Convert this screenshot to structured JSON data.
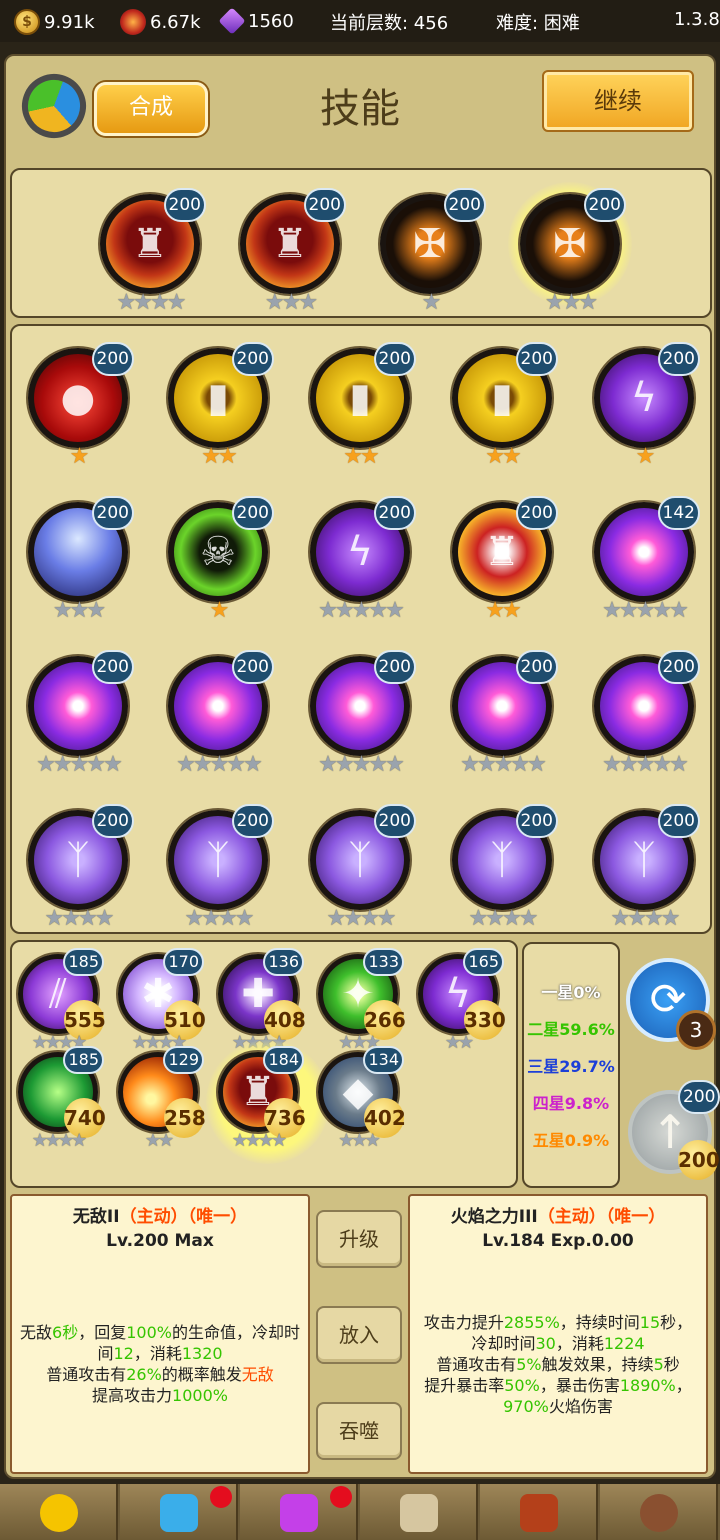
{
  "topbar": {
    "gold": "9.91k",
    "fire": "6.67k",
    "gem": "1560",
    "floor": "当前层数: 456",
    "difficulty": "难度: 困难",
    "version": "1.3.8"
  },
  "header": {
    "title": "技能",
    "compose_label": "合成",
    "continue_label": "继续"
  },
  "equipped": [
    {
      "icon": "crimson-armor-icon",
      "level": "200",
      "stars": 4,
      "filled": 0,
      "glow": false
    },
    {
      "icon": "crimson-armor-icon",
      "level": "200",
      "stars": 3,
      "filled": 0,
      "glow": false
    },
    {
      "icon": "holy-cross-icon",
      "level": "200",
      "stars": 1,
      "filled": 0,
      "glow": false
    },
    {
      "icon": "holy-cross-icon",
      "level": "200",
      "stars": 3,
      "filled": 0,
      "glow": true
    }
  ],
  "grid": [
    {
      "icon": "blood-drop-icon",
      "level": "200",
      "stars": 1,
      "filled": 1
    },
    {
      "icon": "gold-coin-icon",
      "level": "200",
      "stars": 2,
      "filled": 2
    },
    {
      "icon": "gold-coin-icon",
      "level": "200",
      "stars": 2,
      "filled": 2
    },
    {
      "icon": "gold-coin-icon",
      "level": "200",
      "stars": 2,
      "filled": 2
    },
    {
      "icon": "purple-lightning-icon",
      "level": "200",
      "stars": 1,
      "filled": 1
    },
    {
      "icon": "blue-spikes-icon",
      "level": "200",
      "stars": 3,
      "filled": 0
    },
    {
      "icon": "green-skull-icon",
      "level": "200",
      "stars": 1,
      "filled": 1
    },
    {
      "icon": "purple-lightning-icon",
      "level": "200",
      "stars": 5,
      "filled": 0
    },
    {
      "icon": "flame-armor-icon",
      "level": "200",
      "stars": 2,
      "filled": 2
    },
    {
      "icon": "vortex-icon",
      "level": "142",
      "stars": 5,
      "filled": 0
    },
    {
      "icon": "vortex-icon",
      "level": "200",
      "stars": 5,
      "filled": 0
    },
    {
      "icon": "vortex-icon",
      "level": "200",
      "stars": 5,
      "filled": 0
    },
    {
      "icon": "vortex-icon",
      "level": "200",
      "stars": 5,
      "filled": 0
    },
    {
      "icon": "vortex-icon",
      "level": "200",
      "stars": 5,
      "filled": 0
    },
    {
      "icon": "vortex-icon",
      "level": "200",
      "stars": 5,
      "filled": 0
    },
    {
      "icon": "shadow-rune-icon",
      "level": "200",
      "stars": 4,
      "filled": 0
    },
    {
      "icon": "shadow-rune-icon",
      "level": "200",
      "stars": 4,
      "filled": 0
    },
    {
      "icon": "shadow-rune-icon",
      "level": "200",
      "stars": 4,
      "filled": 0
    },
    {
      "icon": "shadow-rune-icon",
      "level": "200",
      "stars": 4,
      "filled": 0
    },
    {
      "icon": "shadow-rune-icon",
      "level": "200",
      "stars": 4,
      "filled": 0
    }
  ],
  "inventory": [
    {
      "icon": "claw-slash-icon",
      "level": "185",
      "cost": "555",
      "stars": 4,
      "glow": false
    },
    {
      "icon": "snowflake-icon",
      "level": "170",
      "cost": "510",
      "stars": 4,
      "glow": false
    },
    {
      "icon": "ghost-cross-icon",
      "level": "136",
      "cost": "408",
      "stars": 4,
      "glow": false
    },
    {
      "icon": "leaf-kick-icon",
      "level": "133",
      "cost": "266",
      "stars": 3,
      "glow": false
    },
    {
      "icon": "purple-lightning-icon",
      "level": "165",
      "cost": "330",
      "stars": 2,
      "glow": false
    },
    {
      "icon": "poison-mist-icon",
      "level": "185",
      "cost": "740",
      "stars": 4,
      "glow": false
    },
    {
      "icon": "fireball-icon",
      "level": "129",
      "cost": "258",
      "stars": 2,
      "glow": false
    },
    {
      "icon": "crimson-armor-icon",
      "level": "184",
      "cost": "736",
      "stars": 4,
      "glow": true
    },
    {
      "icon": "rock-fist-icon",
      "level": "134",
      "cost": "402",
      "stars": 3,
      "glow": false
    }
  ],
  "probabilities": [
    {
      "label": "一星0%",
      "color": "#ffffff"
    },
    {
      "label": "二星59.6%",
      "color": "#35c400"
    },
    {
      "label": "三星29.7%",
      "color": "#1c3fd8"
    },
    {
      "label": "四星9.8%",
      "color": "#cc22cc"
    },
    {
      "label": "五星0.9%",
      "color": "#ff8a00"
    }
  ],
  "refresh": {
    "count": "3"
  },
  "upgrade": {
    "level": "200",
    "cost": "200"
  },
  "left_info": {
    "name": "无敌II",
    "tag": "（主动）（唯一）",
    "level": "Lv.200 Max"
  },
  "right_info": {
    "name": "火焰之力III",
    "tag": "（主动）（唯一）",
    "level": "Lv.184 Exp.0.00"
  },
  "actions": {
    "upgrade": "升级",
    "put": "放入",
    "devour": "吞噬"
  },
  "tabs": [
    {
      "icon": "hero-icon",
      "badge": false
    },
    {
      "icon": "crystal-icon",
      "badge": true
    },
    {
      "icon": "magic-hand-icon",
      "badge": true
    },
    {
      "icon": "anvil-icon",
      "badge": false
    },
    {
      "icon": "spellbook-icon",
      "badge": false
    },
    {
      "icon": "gear-icon",
      "badge": false
    }
  ]
}
